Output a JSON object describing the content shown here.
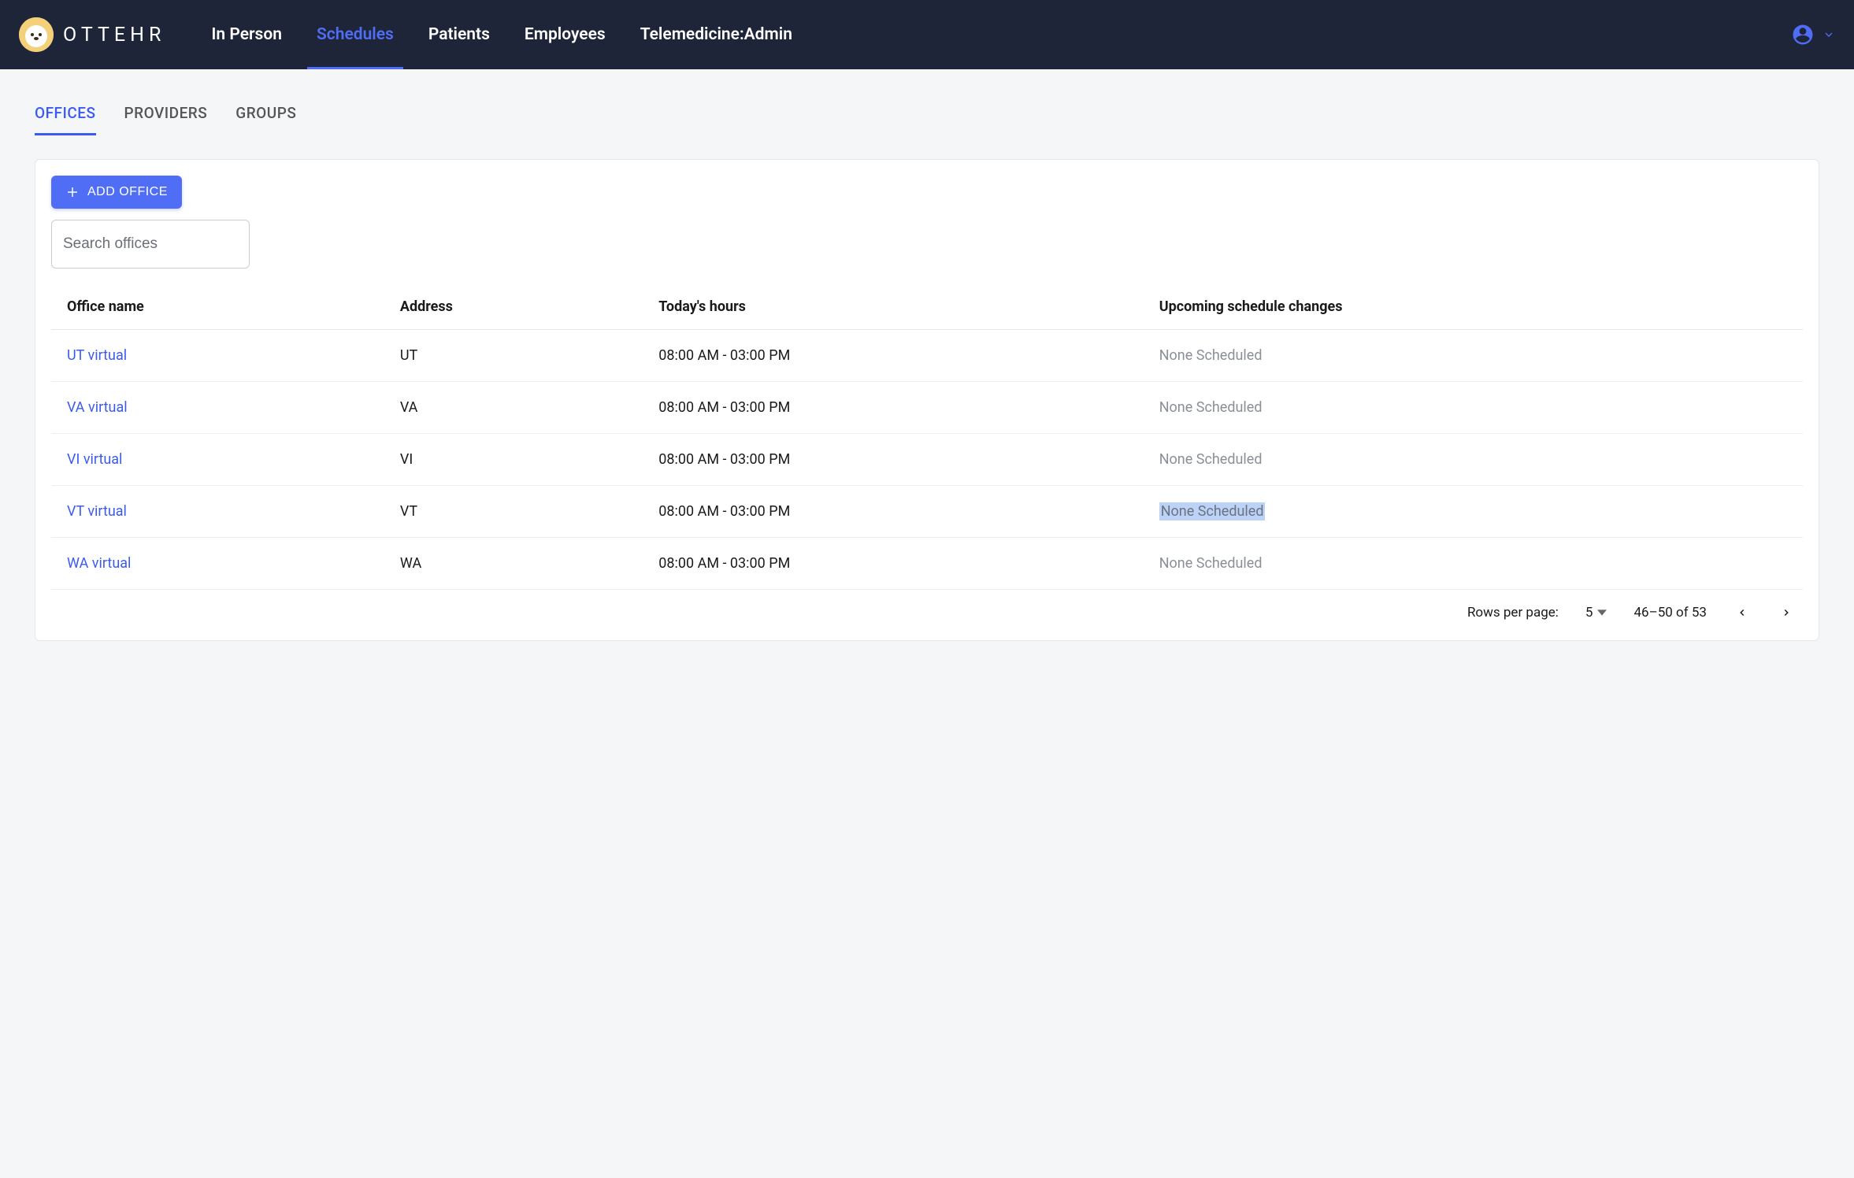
{
  "brand": {
    "name": "OTTEHR"
  },
  "nav": {
    "items": [
      {
        "label": "In Person",
        "active": false
      },
      {
        "label": "Schedules",
        "active": true
      },
      {
        "label": "Patients",
        "active": false
      },
      {
        "label": "Employees",
        "active": false
      },
      {
        "label": "Telemedicine:Admin",
        "active": false
      }
    ]
  },
  "tabs": {
    "items": [
      {
        "label": "OFFICES",
        "active": true
      },
      {
        "label": "PROVIDERS",
        "active": false
      },
      {
        "label": "GROUPS",
        "active": false
      }
    ]
  },
  "toolbar": {
    "add_label": "ADD OFFICE",
    "search_placeholder": "Search offices"
  },
  "table": {
    "columns": [
      "Office name",
      "Address",
      "Today's hours",
      "Upcoming schedule changes"
    ],
    "rows": [
      {
        "name": "UT virtual",
        "address": "UT",
        "hours": "08:00 AM - 03:00 PM",
        "upcoming": "None Scheduled",
        "highlighted": false
      },
      {
        "name": "VA virtual",
        "address": "VA",
        "hours": "08:00 AM - 03:00 PM",
        "upcoming": "None Scheduled",
        "highlighted": false
      },
      {
        "name": "VI virtual",
        "address": "VI",
        "hours": "08:00 AM - 03:00 PM",
        "upcoming": "None Scheduled",
        "highlighted": false
      },
      {
        "name": "VT virtual",
        "address": "VT",
        "hours": "08:00 AM - 03:00 PM",
        "upcoming": "None Scheduled",
        "highlighted": true
      },
      {
        "name": "WA virtual",
        "address": "WA",
        "hours": "08:00 AM - 03:00 PM",
        "upcoming": "None Scheduled",
        "highlighted": false
      }
    ]
  },
  "pagination": {
    "rows_label": "Rows per page:",
    "rows_value": "5",
    "range": "46–50 of 53"
  }
}
